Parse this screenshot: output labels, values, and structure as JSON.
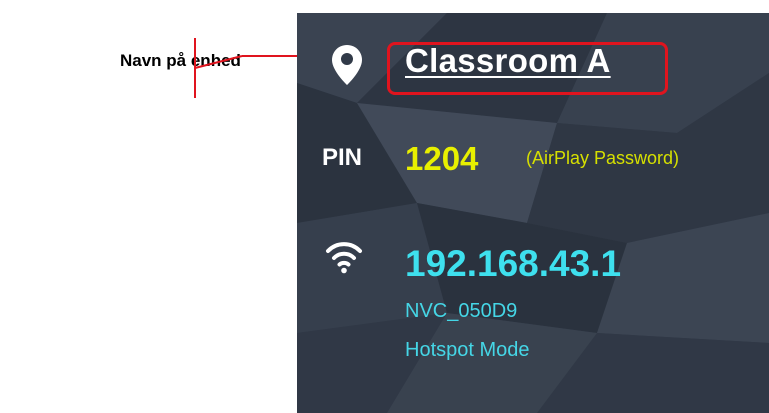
{
  "callout": {
    "label": "Navn på enhed"
  },
  "device": {
    "name": "Classroom A",
    "location_icon": "location-pin-icon"
  },
  "pin": {
    "label": "PIN",
    "value": "1204",
    "note": "(AirPlay Password)"
  },
  "network": {
    "wifi_icon": "wifi-icon",
    "ip": "192.168.43.1",
    "ssid": "NVC_050D9",
    "mode": "Hotspot Mode"
  },
  "colors": {
    "panel_background": "#313a48",
    "highlight": "#e0141e",
    "pin_value": "#e8f000",
    "network_text": "#3ee0ee"
  }
}
